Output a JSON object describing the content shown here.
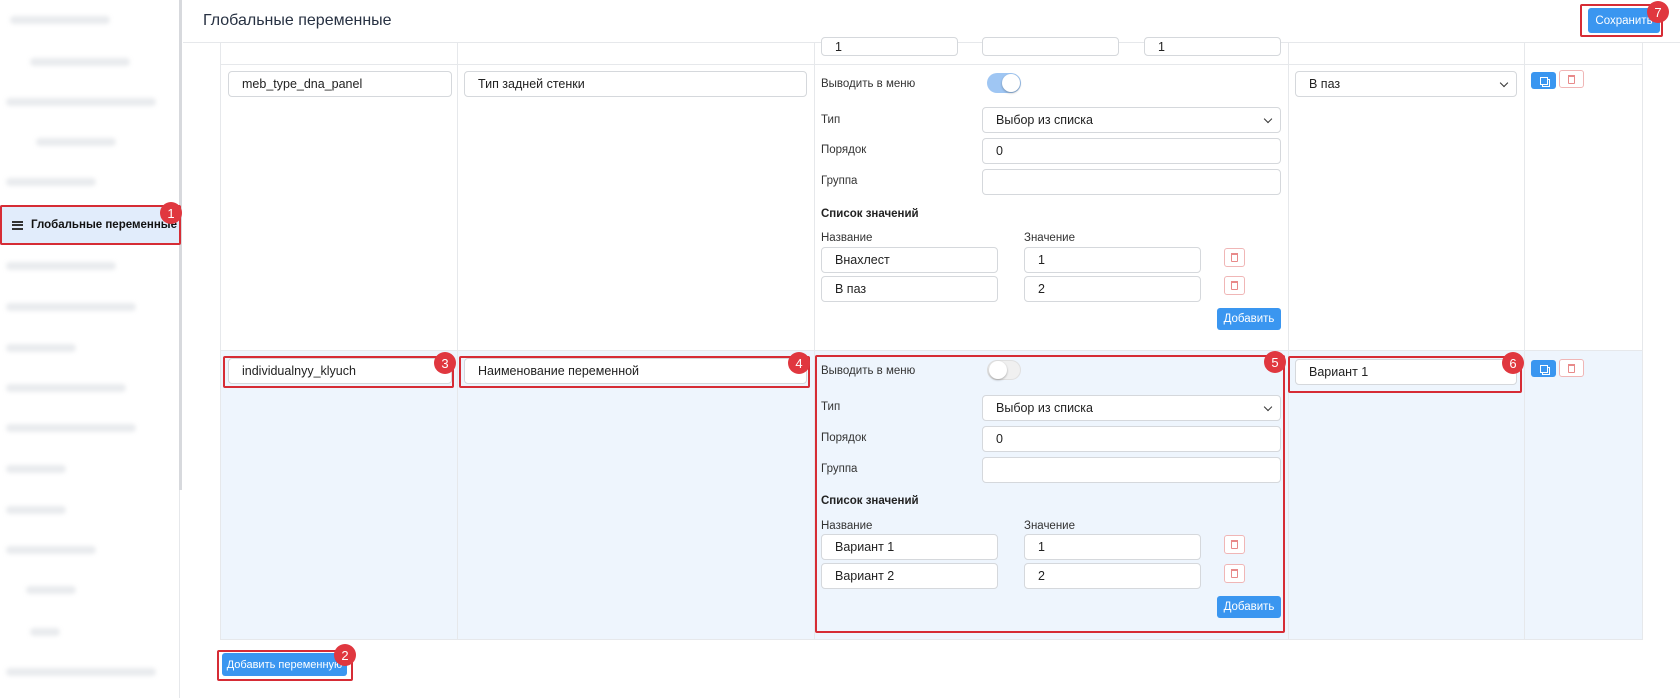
{
  "sidebar": {
    "active_item": "Глобальные переменные",
    "scroll_visible": true
  },
  "header": {
    "title": "Глобальные переменные",
    "save_label": "Сохранить"
  },
  "top_row_partial": {
    "inputs": [
      "1",
      "",
      "1"
    ]
  },
  "rows": [
    {
      "key": "meb_type_dna_panel",
      "name": "Тип задней стенки",
      "show_in_menu_label": "Выводить в меню",
      "show_in_menu": true,
      "type_label": "Тип",
      "type_value": "Выбор из списка",
      "order_label": "Порядок",
      "order_value": "0",
      "group_label": "Группа",
      "group_value": "",
      "values_title": "Список значений",
      "col_name": "Название",
      "col_value": "Значение",
      "values": [
        {
          "name": "Внахлест",
          "value": "1"
        },
        {
          "name": "В паз",
          "value": "2"
        }
      ],
      "add_label": "Добавить",
      "default_value": "В паз"
    },
    {
      "key": "individualnyy_klyuch",
      "name": "Наименование переменной",
      "show_in_menu_label": "Выводить в меню",
      "show_in_menu": false,
      "type_label": "Тип",
      "type_value": "Выбор из списка",
      "order_label": "Порядок",
      "order_value": "0",
      "group_label": "Группа",
      "group_value": "",
      "values_title": "Список значений",
      "col_name": "Название",
      "col_value": "Значение",
      "values": [
        {
          "name": "Вариант 1",
          "value": "1"
        },
        {
          "name": "Вариант 2",
          "value": "2"
        }
      ],
      "add_label": "Добавить",
      "default_value": "Вариант 1"
    }
  ],
  "footer": {
    "add_variable_label": "Добавить переменную"
  },
  "annotations": [
    "1",
    "2",
    "3",
    "4",
    "5",
    "6",
    "7"
  ],
  "colors": {
    "primary": "#3a96f0",
    "highlight": "#d62c35",
    "badge": "#e0373f",
    "active_row": "#eef5fd",
    "sidebar_active": "#e1ecfb"
  }
}
